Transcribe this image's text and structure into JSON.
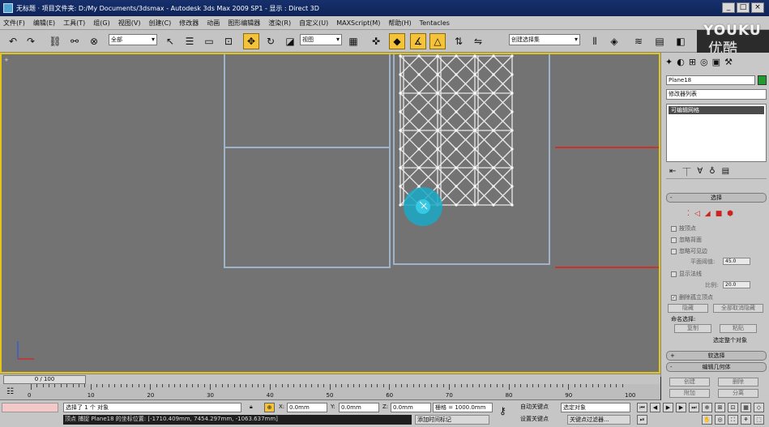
{
  "window": {
    "title": "无标题    · 项目文件夹: D:/My Documents/3dsmax    - Autodesk 3ds Max  2009 SP1    - 显示 : Direct 3D",
    "controls": [
      "_",
      "□",
      "×"
    ]
  },
  "menu": [
    "文件(F)",
    "编辑(E)",
    "工具(T)",
    "组(G)",
    "视图(V)",
    "创建(C)",
    "修改器",
    "动画",
    "图形编辑器",
    "渲染(R)",
    "自定义(U)",
    "MAXScript(M)",
    "帮助(H)",
    "Tentacles"
  ],
  "toolbar": {
    "selection_filter": "全部",
    "reference_coord": "视图",
    "named_selection_placeholder": "创建选择集",
    "icons": [
      "undo-icon",
      "redo-icon",
      "link-icon",
      "unlink-icon",
      "bind-icon",
      "select-icon",
      "select-by-name-icon",
      "rect-region-icon",
      "window-crossing-icon",
      "move-icon",
      "rotate-icon",
      "scale-icon",
      "pivot-icon",
      "manipulate-icon",
      "snap-3d-icon",
      "angle-snap-icon",
      "percent-snap-icon",
      "spinner-snap-icon",
      "mirror-icon",
      "align-icon",
      "layer-icon",
      "curve-editor-icon",
      "schematic-icon",
      "material-editor-icon",
      "render-setup-icon",
      "render-icon",
      "quick-render-icon"
    ]
  },
  "viewport": {
    "label": "+"
  },
  "command_panel": {
    "object_name": "Plane18",
    "modifier_list": "修改器列表",
    "stack_item": "可编辑网格",
    "selection_title": "选择",
    "by_vertex": "按顶点",
    "ignore_backface": "忽略背面",
    "ignore_visible_edges": "忽略可见边",
    "planar_threshold_label": "平面阈值:",
    "planar_threshold_value": "45.0",
    "show_normals": "显示法线",
    "scale_label": "比例:",
    "scale_value": "20.0",
    "delete_isolated": "删除孤立顶点",
    "hide_button": "隐藏",
    "unhide_all_button": "全部取消隐藏",
    "named_selections": "命名选择:",
    "copy_button": "复制",
    "paste_button": "粘贴",
    "whole_object": "选定整个对象",
    "soft_selection": "软选择",
    "edit_geometry": "编辑几何体",
    "create_button": "创建",
    "delete_button": "删除",
    "attach_button": "附加",
    "detach_button": "分离"
  },
  "time": {
    "slider": "0 / 100",
    "ticks": [
      "0",
      "10",
      "20",
      "30",
      "40",
      "50",
      "60",
      "70",
      "80",
      "90",
      "100"
    ]
  },
  "status": {
    "selected": "选择了 1 个 对象",
    "prompt": "顶点 捕捉 Plane18 的坐标位置: [-1710.409mm, 7454.297mm, -1063.637mm]",
    "x_label": "X:",
    "x_value": "0.0mm",
    "y_label": "Y:",
    "y_value": "0.0mm",
    "z_label": "Z:",
    "z_value": "0.0mm",
    "grid": "栅格 = 1000.0mm",
    "add_time_tag": "添加时间标记",
    "auto_key": "自动关键点",
    "set_key": "设置关键点",
    "selected_obj": "选定对象",
    "key_filters": "关键点过滤器..."
  },
  "watermark": {
    "line1": "YOUKU",
    "line2": "优酷"
  },
  "colors": {
    "viewport_bg": "#737373",
    "active_border": "#e3c51a",
    "selection_red": "#c8332b",
    "object_color": "#1f9b2f"
  }
}
